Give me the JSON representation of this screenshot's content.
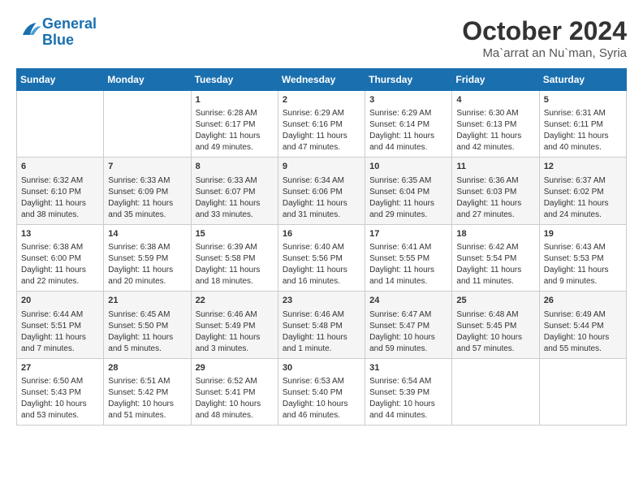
{
  "logo": {
    "line1": "General",
    "line2": "Blue"
  },
  "title": {
    "month_year": "October 2024",
    "location": "Ma`arrat an Nu`man, Syria"
  },
  "header_days": [
    "Sunday",
    "Monday",
    "Tuesday",
    "Wednesday",
    "Thursday",
    "Friday",
    "Saturday"
  ],
  "weeks": [
    [
      {
        "day": "",
        "sunrise": "",
        "sunset": "",
        "daylight": ""
      },
      {
        "day": "",
        "sunrise": "",
        "sunset": "",
        "daylight": ""
      },
      {
        "day": "1",
        "sunrise": "Sunrise: 6:28 AM",
        "sunset": "Sunset: 6:17 PM",
        "daylight": "Daylight: 11 hours and 49 minutes."
      },
      {
        "day": "2",
        "sunrise": "Sunrise: 6:29 AM",
        "sunset": "Sunset: 6:16 PM",
        "daylight": "Daylight: 11 hours and 47 minutes."
      },
      {
        "day": "3",
        "sunrise": "Sunrise: 6:29 AM",
        "sunset": "Sunset: 6:14 PM",
        "daylight": "Daylight: 11 hours and 44 minutes."
      },
      {
        "day": "4",
        "sunrise": "Sunrise: 6:30 AM",
        "sunset": "Sunset: 6:13 PM",
        "daylight": "Daylight: 11 hours and 42 minutes."
      },
      {
        "day": "5",
        "sunrise": "Sunrise: 6:31 AM",
        "sunset": "Sunset: 6:11 PM",
        "daylight": "Daylight: 11 hours and 40 minutes."
      }
    ],
    [
      {
        "day": "6",
        "sunrise": "Sunrise: 6:32 AM",
        "sunset": "Sunset: 6:10 PM",
        "daylight": "Daylight: 11 hours and 38 minutes."
      },
      {
        "day": "7",
        "sunrise": "Sunrise: 6:33 AM",
        "sunset": "Sunset: 6:09 PM",
        "daylight": "Daylight: 11 hours and 35 minutes."
      },
      {
        "day": "8",
        "sunrise": "Sunrise: 6:33 AM",
        "sunset": "Sunset: 6:07 PM",
        "daylight": "Daylight: 11 hours and 33 minutes."
      },
      {
        "day": "9",
        "sunrise": "Sunrise: 6:34 AM",
        "sunset": "Sunset: 6:06 PM",
        "daylight": "Daylight: 11 hours and 31 minutes."
      },
      {
        "day": "10",
        "sunrise": "Sunrise: 6:35 AM",
        "sunset": "Sunset: 6:04 PM",
        "daylight": "Daylight: 11 hours and 29 minutes."
      },
      {
        "day": "11",
        "sunrise": "Sunrise: 6:36 AM",
        "sunset": "Sunset: 6:03 PM",
        "daylight": "Daylight: 11 hours and 27 minutes."
      },
      {
        "day": "12",
        "sunrise": "Sunrise: 6:37 AM",
        "sunset": "Sunset: 6:02 PM",
        "daylight": "Daylight: 11 hours and 24 minutes."
      }
    ],
    [
      {
        "day": "13",
        "sunrise": "Sunrise: 6:38 AM",
        "sunset": "Sunset: 6:00 PM",
        "daylight": "Daylight: 11 hours and 22 minutes."
      },
      {
        "day": "14",
        "sunrise": "Sunrise: 6:38 AM",
        "sunset": "Sunset: 5:59 PM",
        "daylight": "Daylight: 11 hours and 20 minutes."
      },
      {
        "day": "15",
        "sunrise": "Sunrise: 6:39 AM",
        "sunset": "Sunset: 5:58 PM",
        "daylight": "Daylight: 11 hours and 18 minutes."
      },
      {
        "day": "16",
        "sunrise": "Sunrise: 6:40 AM",
        "sunset": "Sunset: 5:56 PM",
        "daylight": "Daylight: 11 hours and 16 minutes."
      },
      {
        "day": "17",
        "sunrise": "Sunrise: 6:41 AM",
        "sunset": "Sunset: 5:55 PM",
        "daylight": "Daylight: 11 hours and 14 minutes."
      },
      {
        "day": "18",
        "sunrise": "Sunrise: 6:42 AM",
        "sunset": "Sunset: 5:54 PM",
        "daylight": "Daylight: 11 hours and 11 minutes."
      },
      {
        "day": "19",
        "sunrise": "Sunrise: 6:43 AM",
        "sunset": "Sunset: 5:53 PM",
        "daylight": "Daylight: 11 hours and 9 minutes."
      }
    ],
    [
      {
        "day": "20",
        "sunrise": "Sunrise: 6:44 AM",
        "sunset": "Sunset: 5:51 PM",
        "daylight": "Daylight: 11 hours and 7 minutes."
      },
      {
        "day": "21",
        "sunrise": "Sunrise: 6:45 AM",
        "sunset": "Sunset: 5:50 PM",
        "daylight": "Daylight: 11 hours and 5 minutes."
      },
      {
        "day": "22",
        "sunrise": "Sunrise: 6:46 AM",
        "sunset": "Sunset: 5:49 PM",
        "daylight": "Daylight: 11 hours and 3 minutes."
      },
      {
        "day": "23",
        "sunrise": "Sunrise: 6:46 AM",
        "sunset": "Sunset: 5:48 PM",
        "daylight": "Daylight: 11 hours and 1 minute."
      },
      {
        "day": "24",
        "sunrise": "Sunrise: 6:47 AM",
        "sunset": "Sunset: 5:47 PM",
        "daylight": "Daylight: 10 hours and 59 minutes."
      },
      {
        "day": "25",
        "sunrise": "Sunrise: 6:48 AM",
        "sunset": "Sunset: 5:45 PM",
        "daylight": "Daylight: 10 hours and 57 minutes."
      },
      {
        "day": "26",
        "sunrise": "Sunrise: 6:49 AM",
        "sunset": "Sunset: 5:44 PM",
        "daylight": "Daylight: 10 hours and 55 minutes."
      }
    ],
    [
      {
        "day": "27",
        "sunrise": "Sunrise: 6:50 AM",
        "sunset": "Sunset: 5:43 PM",
        "daylight": "Daylight: 10 hours and 53 minutes."
      },
      {
        "day": "28",
        "sunrise": "Sunrise: 6:51 AM",
        "sunset": "Sunset: 5:42 PM",
        "daylight": "Daylight: 10 hours and 51 minutes."
      },
      {
        "day": "29",
        "sunrise": "Sunrise: 6:52 AM",
        "sunset": "Sunset: 5:41 PM",
        "daylight": "Daylight: 10 hours and 48 minutes."
      },
      {
        "day": "30",
        "sunrise": "Sunrise: 6:53 AM",
        "sunset": "Sunset: 5:40 PM",
        "daylight": "Daylight: 10 hours and 46 minutes."
      },
      {
        "day": "31",
        "sunrise": "Sunrise: 6:54 AM",
        "sunset": "Sunset: 5:39 PM",
        "daylight": "Daylight: 10 hours and 44 minutes."
      },
      {
        "day": "",
        "sunrise": "",
        "sunset": "",
        "daylight": ""
      },
      {
        "day": "",
        "sunrise": "",
        "sunset": "",
        "daylight": ""
      }
    ]
  ]
}
